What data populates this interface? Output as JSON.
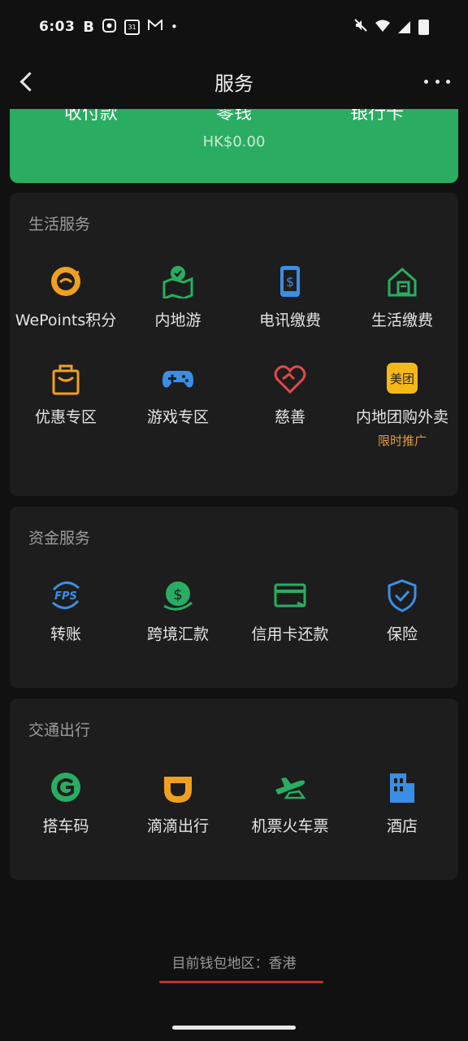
{
  "status_bar": {
    "time": "6:03",
    "b_label": "B",
    "calendar_day": "31",
    "dot": "•"
  },
  "header": {
    "title": "服务"
  },
  "top_card": {
    "items": [
      {
        "label": "收付款",
        "sub": ""
      },
      {
        "label": "零钱",
        "sub": "HK$0.00"
      },
      {
        "label": "银行卡",
        "sub": ""
      }
    ],
    "accent": "#2aad62"
  },
  "sections": [
    {
      "title": "生活服务",
      "items": [
        {
          "label": "WePoints积分",
          "icon": "wepoints-icon"
        },
        {
          "label": "内地游",
          "icon": "map-pin-icon"
        },
        {
          "label": "电讯缴费",
          "icon": "phone-dollar-icon"
        },
        {
          "label": "生活缴费",
          "icon": "house-bill-icon"
        },
        {
          "label": "优惠专区",
          "icon": "gift-bag-icon"
        },
        {
          "label": "游戏专区",
          "icon": "gamepad-icon"
        },
        {
          "label": "慈善",
          "icon": "heart-hands-icon"
        },
        {
          "label": "内地团购外卖",
          "icon": "meituan-icon",
          "sub": "限时推广",
          "logo_text": "美团"
        }
      ]
    },
    {
      "title": "资金服务",
      "items": [
        {
          "label": "转账",
          "icon": "fps-icon",
          "logo_text": "FPS"
        },
        {
          "label": "跨境汇款",
          "icon": "cross-border-remit-icon"
        },
        {
          "label": "信用卡还款",
          "icon": "credit-card-icon"
        },
        {
          "label": "保险",
          "icon": "shield-check-icon"
        }
      ]
    },
    {
      "title": "交通出行",
      "items": [
        {
          "label": "搭车码",
          "icon": "ride-code-icon"
        },
        {
          "label": "滴滴出行",
          "icon": "didi-icon"
        },
        {
          "label": "机票火车票",
          "icon": "plane-train-icon"
        },
        {
          "label": "酒店",
          "icon": "hotel-building-icon"
        }
      ]
    }
  ],
  "footer": {
    "region_text": "目前钱包地区：香港",
    "underline_color": "#d02a1e"
  },
  "colors": {
    "background": "#111111",
    "card": "#1d1d1d",
    "green": "#2aad62",
    "orange": "#f0a020",
    "blue": "#3a8ee6",
    "red": "#e04a4a"
  }
}
